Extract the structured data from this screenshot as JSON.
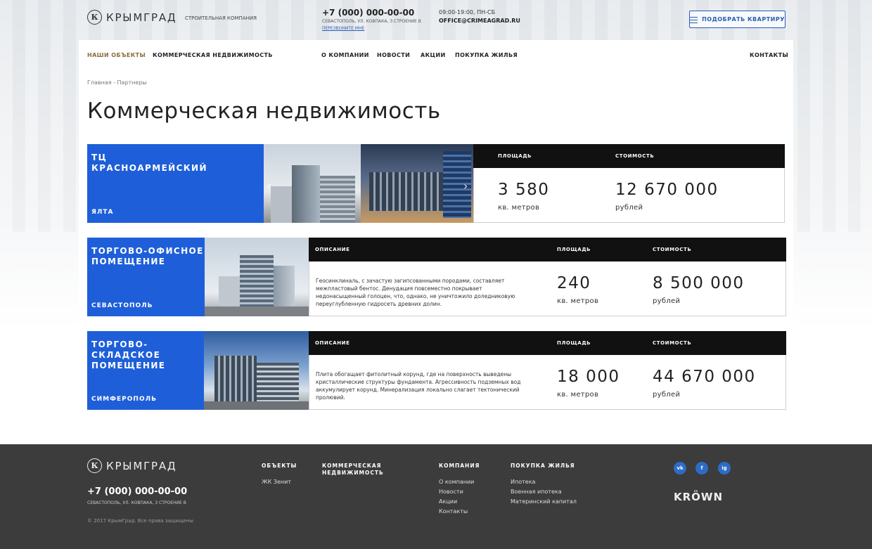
{
  "header": {
    "logo_letter": "К",
    "logo_text": "КРЫМГРАД",
    "tagline": "СТРОИТЕЛЬНАЯ КОМПАНИЯ",
    "phone": "+7 (000) 000-00-00",
    "address": "СЕВАСТОПОЛЬ, УЛ. КОВПАКА, 3 СТРОЕНИЕ В",
    "callback": "ПЕРЕЗВОНИТЕ МНЕ",
    "hours": "09:00-19:00, ПН-СБ",
    "email": "OFFICE@CRIMEAGRAD.RU",
    "pick_button": "ПОДОБРАТЬ КВАРТИРУ"
  },
  "nav": {
    "items": [
      "НАШИ ОБЪЕКТЫ",
      "КОММЕРЧЕСКАЯ НЕДВИЖИМОСТЬ",
      "О КОМПАНИИ",
      "НОВОСТИ",
      "АКЦИИ",
      "ПОКУПКА ЖИЛЬЯ",
      "КОНТАКТЫ"
    ]
  },
  "breadcrumb": "Главная - Партнеры",
  "page_title": "Коммерческая недвижимость",
  "labels": {
    "description": "ОПИСАНИЕ",
    "area": "ПЛОЩАДЬ",
    "price": "СТОИМОСТЬ",
    "area_unit": "кв. метров",
    "price_unit": "рублей"
  },
  "properties": [
    {
      "name_line1": "ТЦ",
      "name_line2": "КРАСНОАРМЕЙСКИЙ",
      "city": "ЯЛТА",
      "area": "3 580",
      "price": "12 670 000"
    },
    {
      "name_line1": "ТОРГОВО-ОФИСНОЕ",
      "name_line2": "ПОМЕЩЕНИЕ",
      "city": "СЕВАСТОПОЛЬ",
      "description_lines": [
        "Геосинклиналь, с зачастую загипсованными породами, составляет",
        "межпластовый бентос. Денудация повсеместно покрывает",
        "недонасыщенный голоцен, что, однако, не уничтожило доледниковую",
        "переуглубленную гидросеть древних долин."
      ],
      "area": "240",
      "price": "8 500 000"
    },
    {
      "name_line1": "ТОРГОВО-СКЛАДСКОЕ",
      "name_line2": "ПОМЕЩЕНИЕ",
      "city": "СИМФЕРОПОЛЬ",
      "description_lines": [
        "Плита обогащает фитолитный корунд, где на поверхность выведены",
        "кристаллические структуры фундамента. Агрессивность подземных вод",
        "аккумулирует корунд. Минерализация локально слагает тектонический",
        "пролювий."
      ],
      "area": "18 000",
      "price": "44 670 000"
    }
  ],
  "footer": {
    "logo_letter": "К",
    "logo_text": "КРЫМГРАД",
    "phone": "+7 (000) 000-00-00",
    "address": "СЕВАСТОПОЛЬ, УЛ. КОВПАКА, 3 СТРОЕНИЕ В",
    "copyright": "© 2017 КрымГрад. Все права защищены",
    "col_objects": {
      "title": "ОБЪЕКТЫ",
      "links": [
        "ЖК Зенит"
      ]
    },
    "col_commercial": {
      "title_line1": "КОММЕРЧЕСКАЯ",
      "title_line2": "НЕДВИЖИМОСТЬ"
    },
    "col_company": {
      "title": "КОМПАНИЯ",
      "links": [
        "О компании",
        "Новости",
        "Акции",
        "Контакты"
      ]
    },
    "col_buy": {
      "title": "ПОКУПКА ЖИЛЬЯ",
      "links": [
        "Ипотека",
        "Военная ипотека",
        "Материнский капитал"
      ]
    },
    "social": [
      "vk",
      "f",
      "ig"
    ],
    "partner": "KRÖWN"
  },
  "colors": {
    "accent_blue": "#1e5fd9",
    "link_blue": "#2a5db0",
    "nav_active": "#8a6d3b",
    "footer_bg": "#3c3c3c"
  }
}
